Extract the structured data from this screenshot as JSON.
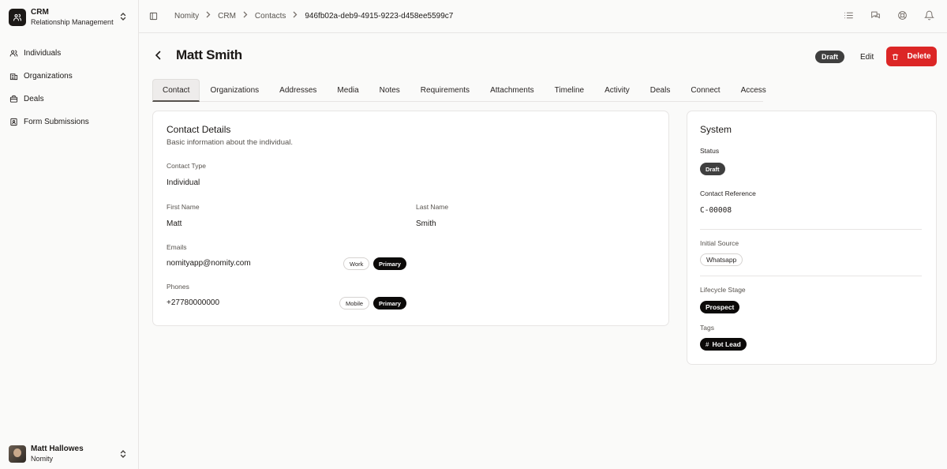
{
  "sidebar": {
    "brand_title": "CRM",
    "brand_subtitle": "Relationship Management",
    "items": [
      {
        "label": "Individuals",
        "icon": "users-icon"
      },
      {
        "label": "Organizations",
        "icon": "building-icon"
      },
      {
        "label": "Deals",
        "icon": "briefcase-icon"
      },
      {
        "label": "Form Submissions",
        "icon": "form-icon"
      }
    ],
    "user": {
      "name": "Matt Hallowes",
      "org": "Nomity"
    }
  },
  "breadcrumb": [
    "Nomity",
    "CRM",
    "Contacts",
    "946fb02a-deb9-4915-9223-d458ee5599c7"
  ],
  "header": {
    "title": "Matt Smith",
    "status": "Draft",
    "edit_label": "Edit",
    "delete_label": "Delete"
  },
  "tabs": [
    "Contact",
    "Organizations",
    "Addresses",
    "Media",
    "Notes",
    "Requirements",
    "Attachments",
    "Timeline",
    "Activity",
    "Deals",
    "Connect",
    "Access"
  ],
  "active_tab": "Contact",
  "contact": {
    "title": "Contact Details",
    "description": "Basic information about the individual.",
    "type_label": "Contact Type",
    "type_value": "Individual",
    "first_name_label": "First Name",
    "first_name": "Matt",
    "last_name_label": "Last Name",
    "last_name": "Smith",
    "emails_label": "Emails",
    "email": {
      "value": "nomityapp@nomity.com",
      "type": "Work",
      "primary": "Primary"
    },
    "phones_label": "Phones",
    "phone": {
      "value": "+27780000000",
      "type": "Mobile",
      "primary": "Primary"
    }
  },
  "system": {
    "title": "System",
    "status_label": "Status",
    "status": "Draft",
    "reference_label": "Contact Reference",
    "reference": "C-00008",
    "source_label": "Initial Source",
    "source": "Whatsapp",
    "lifecycle_label": "Lifecycle Stage",
    "lifecycle": "Prospect",
    "tags_label": "Tags",
    "tag": "Hot Lead"
  },
  "colors": {
    "danger": "#dc2626",
    "dark": "#0c0a09",
    "muted": "#57534e"
  }
}
